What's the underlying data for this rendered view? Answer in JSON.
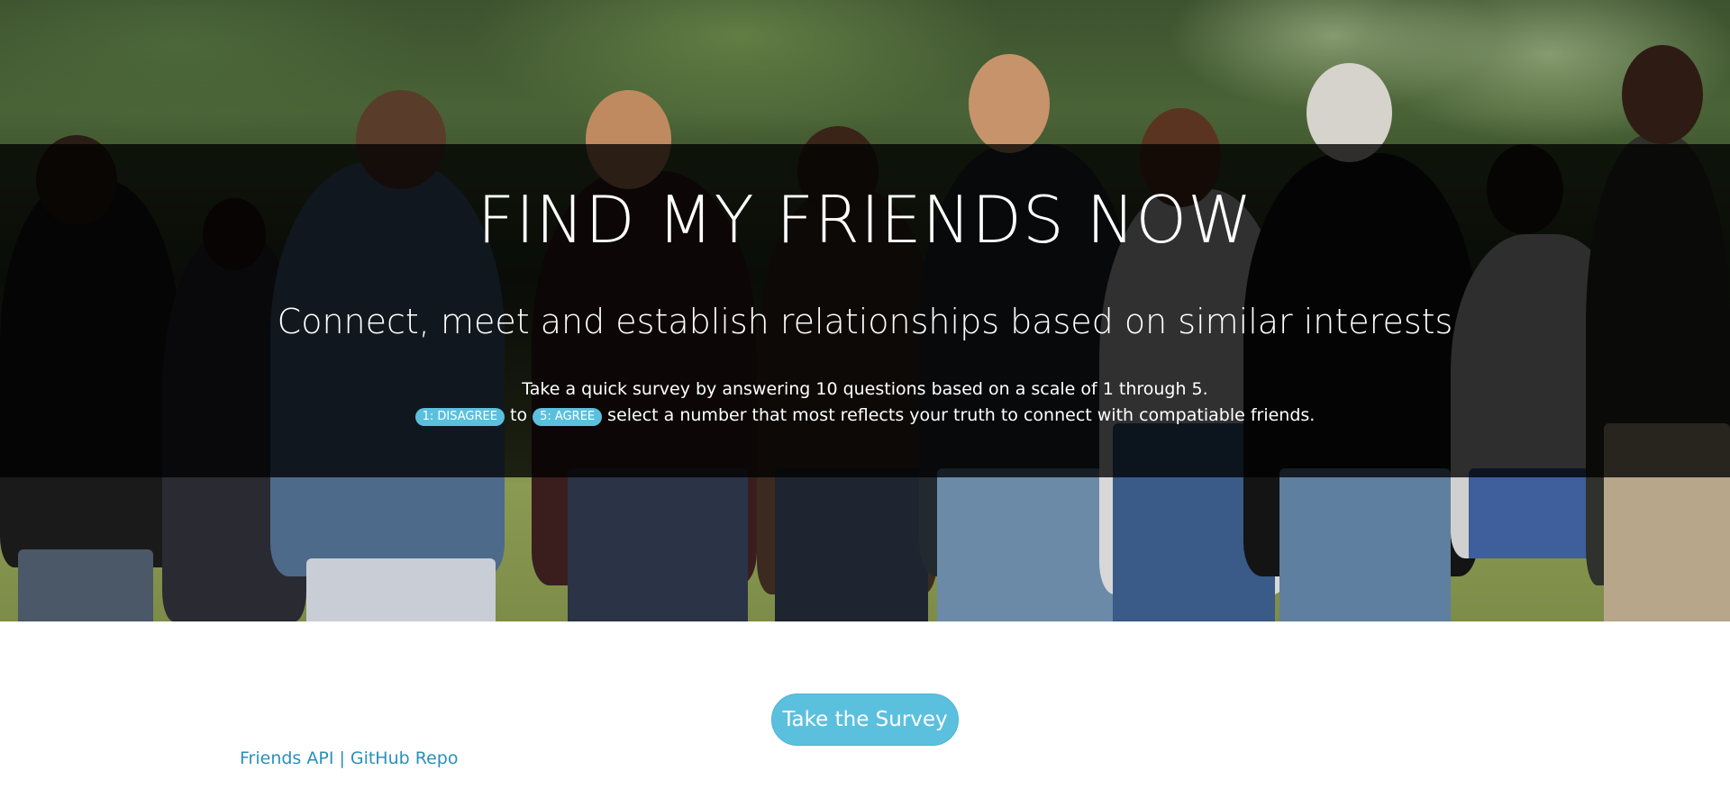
{
  "hero": {
    "title": "FIND MY FRIENDS NOW",
    "subtitle": "Connect, meet and establish relationships based on similar interests",
    "description_line1": "Take a quick survey by answering 10 questions based on a scale of 1 through 5.",
    "badge_disagree": "1: DISAGREE",
    "connector_to": "to",
    "badge_agree": "5: AGREE",
    "description_line2_rest": "select a number that most reflects your truth to connect with compatiable friends."
  },
  "cta": {
    "label": "Take the Survey"
  },
  "footer": {
    "link_api": "Friends API",
    "separator": "|",
    "link_repo": "GitHub Repo"
  },
  "colors": {
    "accent": "#5bc0de",
    "link": "#2a8fbd",
    "overlay": "rgba(0,0,0,0.78)"
  }
}
